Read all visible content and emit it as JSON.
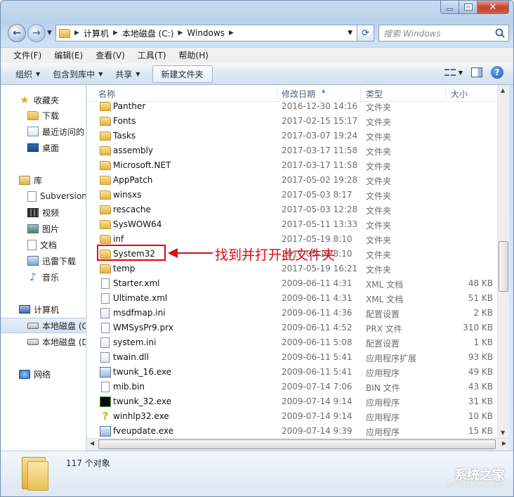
{
  "address": {
    "segments": [
      "计算机",
      "本地磁盘 (C:)",
      "Windows"
    ],
    "search_placeholder": "搜索 Windows"
  },
  "menu": [
    "文件(F)",
    "编辑(E)",
    "查看(V)",
    "工具(T)",
    "帮助(H)"
  ],
  "toolbar": {
    "organize": "组织",
    "include_in_library": "包含到库中",
    "share": "共享",
    "new_folder": "新建文件夹"
  },
  "navpane": {
    "favorites": "收藏夹",
    "downloads": "下载",
    "recent": "最近访问的",
    "desktop": "桌面",
    "libraries": "库",
    "subversion": "Subversion",
    "videos": "视频",
    "pictures": "图片",
    "documents": "文档",
    "xunlei": "迅雷下载",
    "music": "音乐",
    "computer": "计算机",
    "local_disk_c": "本地磁盘 (C",
    "local_disk_d": "本地磁盘 (D",
    "network": "网络"
  },
  "columns": {
    "name": "名称",
    "date": "修改日期",
    "type": "类型",
    "size": "大小"
  },
  "files": [
    {
      "name": "Panther",
      "date": "2016-12-30 14:16",
      "type": "文件夹",
      "size": "",
      "icon": "folder"
    },
    {
      "name": "Fonts",
      "date": "2017-02-15 15:17",
      "type": "文件夹",
      "size": "",
      "icon": "folder"
    },
    {
      "name": "Tasks",
      "date": "2017-03-07 19:24",
      "type": "文件夹",
      "size": "",
      "icon": "folder"
    },
    {
      "name": "assembly",
      "date": "2017-03-17 11:58",
      "type": "文件夹",
      "size": "",
      "icon": "folder"
    },
    {
      "name": "Microsoft.NET",
      "date": "2017-03-17 11:58",
      "type": "文件夹",
      "size": "",
      "icon": "folder"
    },
    {
      "name": "AppPatch",
      "date": "2017-05-02 19:28",
      "type": "文件夹",
      "size": "",
      "icon": "folder"
    },
    {
      "name": "winsxs",
      "date": "2017-05-03 8:17",
      "type": "文件夹",
      "size": "",
      "icon": "folder"
    },
    {
      "name": "rescache",
      "date": "2017-05-03 12:28",
      "type": "文件夹",
      "size": "",
      "icon": "folder"
    },
    {
      "name": "SysWOW64",
      "date": "2017-05-11 13:33",
      "type": "文件夹",
      "size": "",
      "icon": "folder"
    },
    {
      "name": "inf",
      "date": "2017-05-19 8:10",
      "type": "文件夹",
      "size": "",
      "icon": "folder"
    },
    {
      "name": "System32",
      "date": "2017-05-19 8:10",
      "type": "文件夹",
      "size": "",
      "icon": "folder"
    },
    {
      "name": "temp",
      "date": "2017-05-19 16:21",
      "type": "文件夹",
      "size": "",
      "icon": "folder"
    },
    {
      "name": "Starter.xml",
      "date": "2009-06-11 4:31",
      "type": "XML 文档",
      "size": "48 KB",
      "icon": "file"
    },
    {
      "name": "Ultimate.xml",
      "date": "2009-06-11 4:31",
      "type": "XML 文档",
      "size": "51 KB",
      "icon": "file"
    },
    {
      "name": "msdfmap.ini",
      "date": "2009-06-11 4:36",
      "type": "配置设置",
      "size": "2 KB",
      "icon": "cfg"
    },
    {
      "name": "WMSysPr9.prx",
      "date": "2009-06-11 4:52",
      "type": "PRX 文件",
      "size": "310 KB",
      "icon": "file"
    },
    {
      "name": "system.ini",
      "date": "2009-06-11 5:08",
      "type": "配置设置",
      "size": "1 KB",
      "icon": "cfg"
    },
    {
      "name": "twain.dll",
      "date": "2009-06-11 5:41",
      "type": "应用程序扩展",
      "size": "93 KB",
      "icon": "dll"
    },
    {
      "name": "twunk_16.exe",
      "date": "2009-06-11 5:41",
      "type": "应用程序",
      "size": "49 KB",
      "icon": "app"
    },
    {
      "name": "mib.bin",
      "date": "2009-07-14 7:06",
      "type": "BIN 文件",
      "size": "43 KB",
      "icon": "file"
    },
    {
      "name": "twunk_32.exe",
      "date": "2009-07-14 9:14",
      "type": "应用程序",
      "size": "31 KB",
      "icon": "twunk32"
    },
    {
      "name": "winhlp32.exe",
      "date": "2009-07-14 9:14",
      "type": "应用程序",
      "size": "10 KB",
      "icon": "help"
    },
    {
      "name": "fveupdate.exe",
      "date": "2009-07-14 9:39",
      "type": "应用程序",
      "size": "15 KB",
      "icon": "app"
    }
  ],
  "annotation": "找到并打开此文件夹",
  "status": {
    "object_count": "117 个对象"
  },
  "watermark": {
    "main": "系统之家",
    "sub": "XITONGZHIJIA.NET"
  }
}
